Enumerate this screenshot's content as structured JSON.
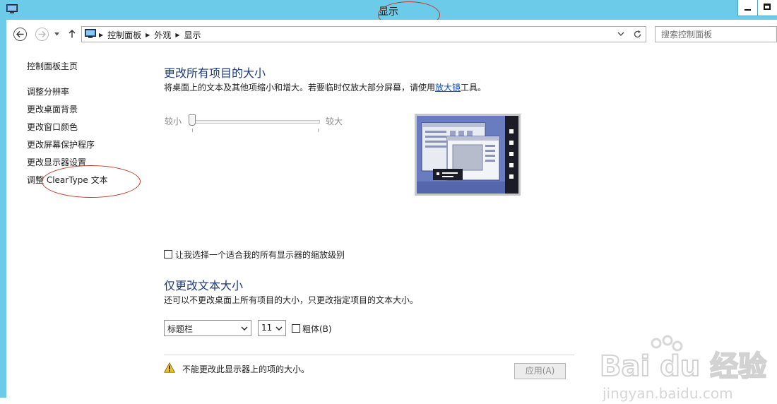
{
  "window": {
    "title": "显示"
  },
  "address": {
    "crumbs": [
      "控制面板",
      "外观",
      "显示"
    ]
  },
  "search": {
    "placeholder": "搜索控制面板"
  },
  "sidebar": {
    "home": "控制面板主页",
    "items": [
      "调整分辨率",
      "更改桌面背景",
      "更改窗口颜色",
      "更改屏幕保护程序",
      "更改显示器设置",
      "调整 ClearType 文本"
    ]
  },
  "size_section": {
    "heading": "更改所有项目的大小",
    "desc_before": "将桌面上的文本及其他项缩小和增大。若要临时仅放大部分屏幕，请使用",
    "desc_link": "放大镜",
    "desc_after": "工具。",
    "slider_min_label": "较小",
    "slider_max_label": "较大",
    "slider_value": 0
  },
  "custom_scaling": {
    "label": "让我选择一个适合我的所有显示器的缩放级别",
    "checked": false
  },
  "text_section": {
    "heading": "仅更改文本大小",
    "desc": "还可以不更改桌面上所有项目的大小，只更改指定项目的文本大小。",
    "item_select": "标题栏",
    "size_select": "11",
    "bold_label": "粗体(B)",
    "bold_checked": false
  },
  "footer": {
    "warning": "不能更改此显示器上的项的大小。",
    "apply_label": "应用(A)"
  },
  "watermark": {
    "brand": "Bai du 经验",
    "url": "jingyan.baidu.com"
  },
  "colors": {
    "titlebar": "#6ccbe8",
    "link": "#0b4fc6",
    "heading": "#1e3a78",
    "annotation": "#c0392b"
  }
}
